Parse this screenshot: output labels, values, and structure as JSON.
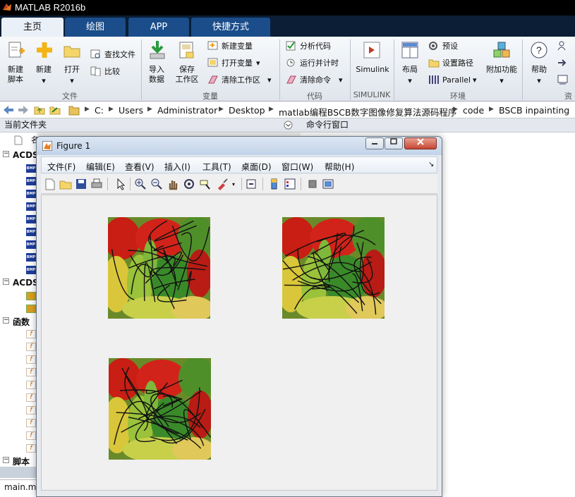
{
  "app": {
    "title": "MATLAB R2016b"
  },
  "tabs": [
    "主页",
    "绘图",
    "APP",
    "快捷方式"
  ],
  "ribbon": {
    "file": {
      "new_script": "新建\n脚本",
      "new": "新建",
      "open": "打开",
      "find_files": "查找文件",
      "compare": "比较",
      "group": "文件"
    },
    "variable": {
      "import": "导入\n数据",
      "save_workspace": "保存\n工作区",
      "new_variable": "新建变量",
      "open_variable": "打开变量",
      "clear_workspace": "清除工作区",
      "group": "变量"
    },
    "code": {
      "analyze": "分析代码",
      "run_time": "运行并计时",
      "clear_commands": "清除命令",
      "group": "代码"
    },
    "simulink": {
      "label": "Simulink",
      "group": "SIMULINK"
    },
    "environment": {
      "layout": "布局",
      "preferences": "预设",
      "set_path": "设置路径",
      "parallel": "Parallel",
      "addons": "附加功能",
      "group": "环境"
    },
    "resources": {
      "help": "帮助",
      "group": "资"
    }
  },
  "address": {
    "crumbs": [
      "C:",
      "Users",
      "Administrator",
      "Desktop",
      "matlab编程BSCB数字图像修复算法源码程序",
      "code",
      "BSCB inpainting"
    ]
  },
  "panes": {
    "current_folder": "当前文件夹",
    "command_window": "命令行窗口"
  },
  "left_tree": {
    "section1": "ACDS",
    "section2": "ACDS",
    "section3": "函数",
    "section4": "脚本",
    "footer_file": "main.m"
  },
  "figure": {
    "title": "Figure 1",
    "menu": [
      "文件(F)",
      "编辑(E)",
      "查看(V)",
      "插入(I)",
      "工具(T)",
      "桌面(D)",
      "窗口(W)",
      "帮助(H)"
    ]
  },
  "icons": {
    "title_logo": "matlab-logo-icon",
    "fig_logo": "figure-logo-icon"
  }
}
